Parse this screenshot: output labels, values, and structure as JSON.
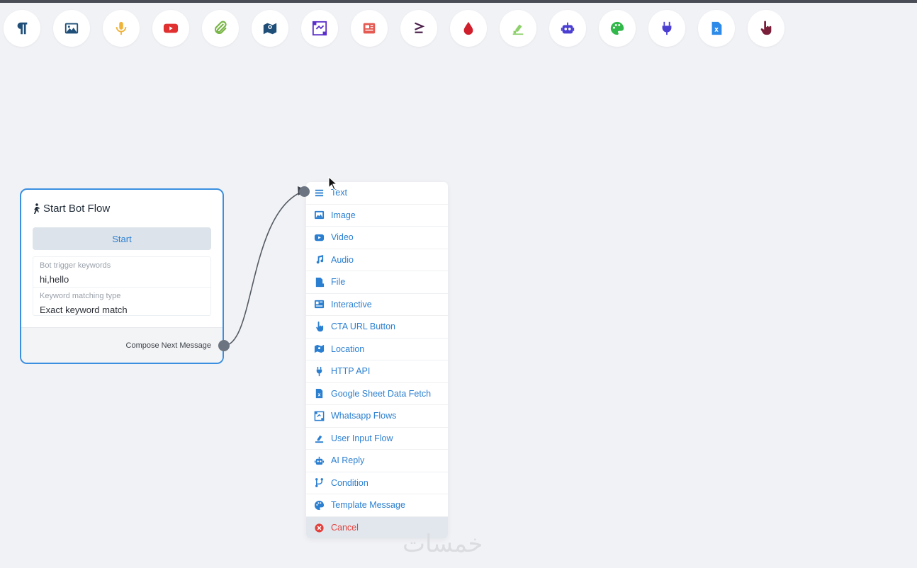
{
  "toolbar": {
    "tools": [
      {
        "icon": "paragraph-icon",
        "color": "#1f4f78"
      },
      {
        "icon": "image-icon",
        "color": "#1f4f78"
      },
      {
        "icon": "audio-icon",
        "color": "#f0b33a"
      },
      {
        "icon": "youtube-icon",
        "color": "#e0302f"
      },
      {
        "icon": "paperclip-icon",
        "color": "#7ab647"
      },
      {
        "icon": "map-icon",
        "color": "#1f4f78"
      },
      {
        "icon": "whatsapp-flows-icon",
        "color": "#5b2fc9"
      },
      {
        "icon": "newspaper-icon",
        "color": "#e55a52"
      },
      {
        "icon": "greater-equal-icon",
        "color": "#4a1f4a"
      },
      {
        "icon": "drop-icon",
        "color": "#d01f2c"
      },
      {
        "icon": "user-input-icon",
        "color": "#8ed06a"
      },
      {
        "icon": "robot-icon",
        "color": "#4b3fd2"
      },
      {
        "icon": "palette-icon",
        "color": "#32b84a"
      },
      {
        "icon": "plug-icon",
        "color": "#4b3fd2"
      },
      {
        "icon": "spreadsheet-icon",
        "color": "#2d8ae8"
      },
      {
        "icon": "hand-pointer-icon",
        "color": "#7a1f3a"
      }
    ]
  },
  "start_node": {
    "title": "Start Bot Flow",
    "start_label": "Start",
    "trigger_label": "Bot trigger keywords",
    "trigger_value": "hi,hello",
    "matching_label": "Keyword matching type",
    "matching_value": "Exact keyword match",
    "compose_label": "Compose Next Message"
  },
  "menu": {
    "items": [
      {
        "label": "Text",
        "icon": "lines-icon"
      },
      {
        "label": "Image",
        "icon": "image-icon"
      },
      {
        "label": "Video",
        "icon": "video-icon"
      },
      {
        "label": "Audio",
        "icon": "music-note-icon"
      },
      {
        "label": "File",
        "icon": "file-icon"
      },
      {
        "label": "Interactive",
        "icon": "interactive-icon"
      },
      {
        "label": "CTA URL Button",
        "icon": "hand-pointer-icon"
      },
      {
        "label": "Location",
        "icon": "map-icon"
      },
      {
        "label": "HTTP API",
        "icon": "plug-icon"
      },
      {
        "label": "Google Sheet Data Fetch",
        "icon": "spreadsheet-icon"
      },
      {
        "label": "Whatsapp Flows",
        "icon": "flows-icon"
      },
      {
        "label": "User Input Flow",
        "icon": "user-input-icon"
      },
      {
        "label": "AI Reply",
        "icon": "robot-icon"
      },
      {
        "label": "Condition",
        "icon": "branch-icon"
      },
      {
        "label": "Template Message",
        "icon": "palette-icon"
      }
    ],
    "cancel_label": "Cancel"
  },
  "watermark": "خمسات",
  "colors": {
    "accent": "#2b7fd0",
    "danger": "#e2413c",
    "node_border": "#3b8fe0"
  }
}
